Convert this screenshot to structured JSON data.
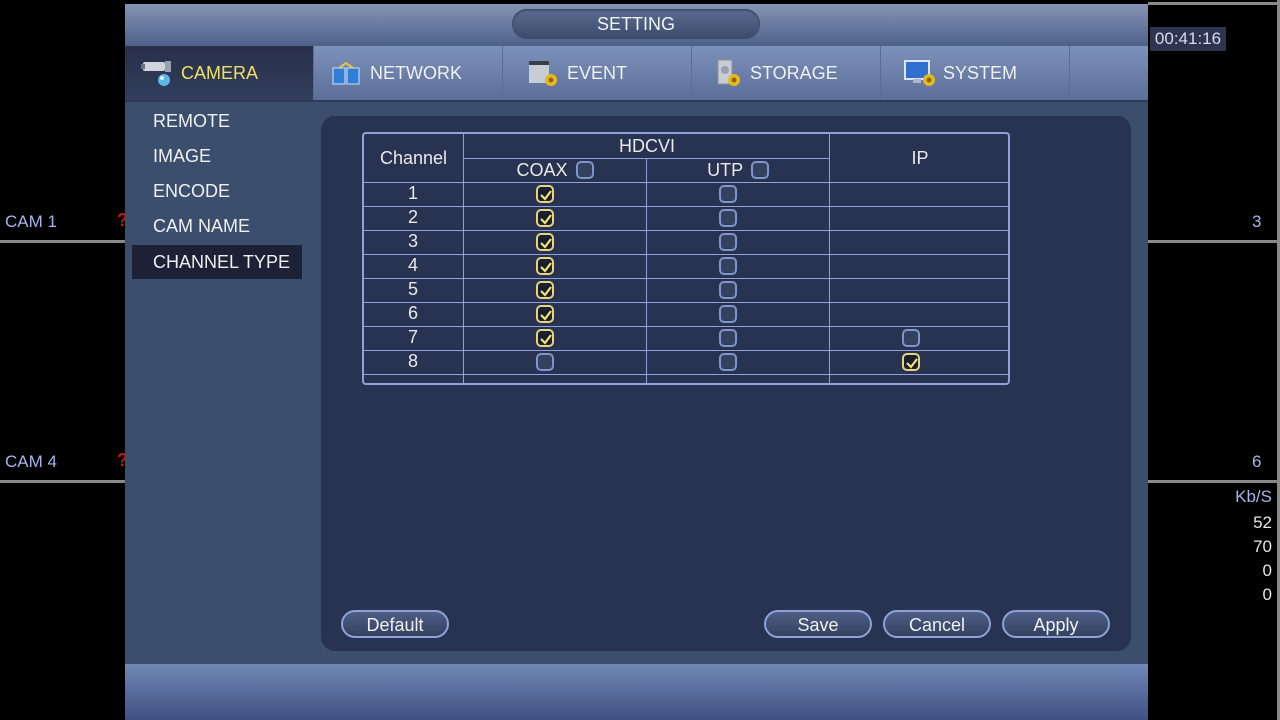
{
  "background": {
    "clock": "00:41:16",
    "cams": [
      {
        "label": "CAM 1",
        "alert": "?"
      },
      {
        "label": "CAM 4",
        "alert": "?"
      },
      {
        "label": "3"
      },
      {
        "label": "6"
      }
    ],
    "bitrate": {
      "header": "Kb/S",
      "values": [
        "52",
        "70",
        "0",
        "0"
      ]
    }
  },
  "window": {
    "title": "SETTING",
    "tabs": [
      {
        "label": "CAMERA",
        "icon": "camera-icon",
        "active": true
      },
      {
        "label": "NETWORK",
        "icon": "network-icon"
      },
      {
        "label": "EVENT",
        "icon": "event-icon"
      },
      {
        "label": "STORAGE",
        "icon": "storage-icon"
      },
      {
        "label": "SYSTEM",
        "icon": "system-icon"
      }
    ],
    "sidebar": [
      {
        "label": "REMOTE"
      },
      {
        "label": "IMAGE"
      },
      {
        "label": "ENCODE"
      },
      {
        "label": "CAM NAME"
      },
      {
        "label": "CHANNEL TYPE",
        "active": true
      }
    ],
    "table": {
      "col_channel": "Channel",
      "col_group": "HDCVI",
      "col_coax": "COAX",
      "col_utp": "UTP",
      "col_ip": "IP",
      "coax_all_checked": false,
      "utp_all_checked": false,
      "rows": [
        {
          "channel": "1",
          "coax": true,
          "utp": false,
          "ip": null
        },
        {
          "channel": "2",
          "coax": true,
          "utp": false,
          "ip": null
        },
        {
          "channel": "3",
          "coax": true,
          "utp": false,
          "ip": null
        },
        {
          "channel": "4",
          "coax": true,
          "utp": false,
          "ip": null
        },
        {
          "channel": "5",
          "coax": true,
          "utp": false,
          "ip": null
        },
        {
          "channel": "6",
          "coax": true,
          "utp": false,
          "ip": null
        },
        {
          "channel": "7",
          "coax": true,
          "utp": false,
          "ip": false
        },
        {
          "channel": "8",
          "coax": false,
          "utp": false,
          "ip": true
        }
      ]
    },
    "buttons": {
      "default": "Default",
      "save": "Save",
      "cancel": "Cancel",
      "apply": "Apply"
    }
  }
}
